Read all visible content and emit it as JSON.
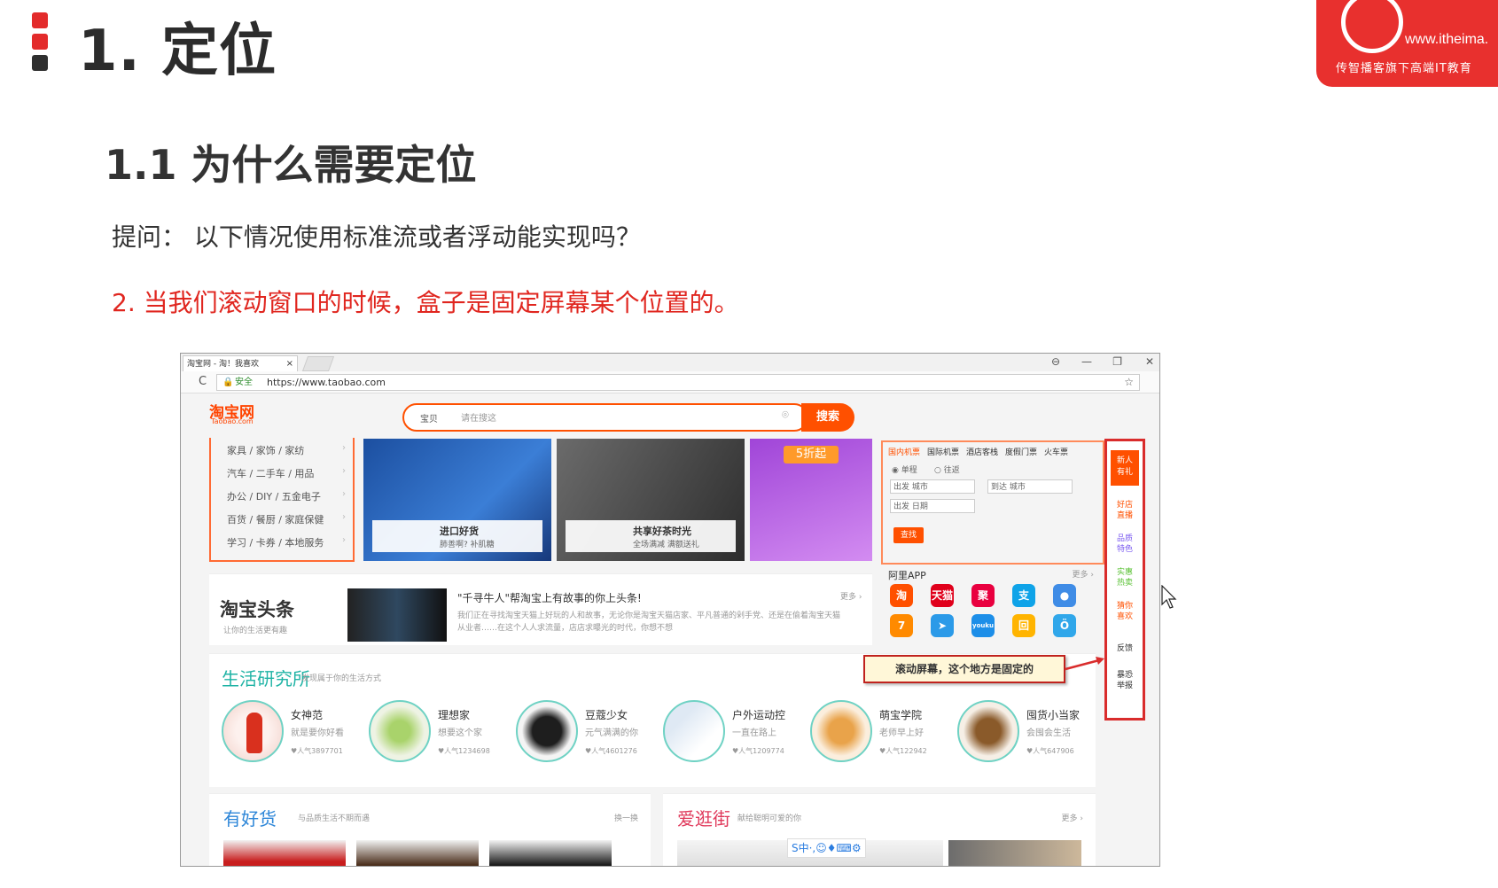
{
  "slide": {
    "h1": "1. 定位",
    "h2": "1.1 为什么需要定位",
    "question": "提问： 以下情况使用标准流或者浮动能实现吗？",
    "point2": "2. 当我们滚动窗口的时候，盒子是固定屏幕某个位置的。"
  },
  "logo": {
    "url": "www.itheima.",
    "slogan": "传智播客旗下高端IT教育"
  },
  "browser": {
    "tab_title": "淘宝网 - 淘！我喜欢",
    "tab_close": "×",
    "window_buttons": [
      "⊖",
      "—",
      "❐",
      "✕"
    ],
    "reload": "C",
    "secure_label": "安全",
    "url": "https://www.taobao.com",
    "star": "☆"
  },
  "taobao": {
    "logo": "淘宝网",
    "logo_en": "Taobao.com",
    "search_type": "宝贝",
    "search_placeholder": "请在搜这",
    "search_button": "搜索",
    "categories": [
      "家具 / 家饰 / 家纺",
      "汽车 / 二手车 / 用品",
      "办公 / DIY / 五金电子",
      "百货 / 餐厨 / 家庭保健",
      "学习 / 卡券 / 本地服务"
    ],
    "banners": [
      {
        "title": "进口好货",
        "sub": "肺善啊? 补肌糖"
      },
      {
        "title": "共享好茶时光",
        "sub": "全场满减 满额送礼"
      },
      {
        "tag": "5折起"
      }
    ],
    "flight": {
      "tabs": [
        "国内机票",
        "国际机票",
        "酒店客栈",
        "度假门票",
        "火车票"
      ],
      "oneway": "单程",
      "return": "往返",
      "from": "出发  城市",
      "to": "到达  城市",
      "date": "出发  日期",
      "button": "查找"
    },
    "news": {
      "logo": "淘宝头条",
      "sub": "让你的生活更有趣",
      "title": "\"千寻牛人\"帮淘宝上有故事的你上头条!",
      "body": "我们正在寻找淘宝天猫上好玩的人和故事，无论你是淘宝天猫店家、平凡普通的剁手党、还是在偷着淘宝天猫从业者……在这个人人求流量，店店求曝光的时代，你想不想",
      "more": "更多 ›"
    },
    "ali_app": {
      "title": "阿里APP",
      "more": "更多 ›",
      "apps": [
        {
          "label": "淘",
          "color": "#ff5000"
        },
        {
          "label": "天猫",
          "color": "#e0001b"
        },
        {
          "label": "聚",
          "color": "#e9003f"
        },
        {
          "label": "支",
          "color": "#0fa3e8"
        },
        {
          "label": "●",
          "color": "#3f8ce6"
        },
        {
          "label": "7",
          "color": "#ff8a00"
        },
        {
          "label": "➤",
          "color": "#2b9ae8"
        },
        {
          "label": "youku",
          "color": "#1c8ee8"
        },
        {
          "label": "回",
          "color": "#ffb400"
        },
        {
          "label": "Ö",
          "color": "#30a7ea"
        }
      ]
    },
    "life": {
      "title": "生活研究所",
      "sub": "发现属于你的生活方式",
      "items": [
        {
          "title": "女神范",
          "sub": "就是要你好看",
          "hot": "♥人气3897701"
        },
        {
          "title": "理想家",
          "sub": "想要这个家",
          "hot": "♥人气1234698"
        },
        {
          "title": "豆蔻少女",
          "sub": "元气满满的你",
          "hot": "♥人气4601276"
        },
        {
          "title": "户外运动控",
          "sub": "一直在路上",
          "hot": "♥人气1209774"
        },
        {
          "title": "萌宝学院",
          "sub": "老师早上好",
          "hot": "♥人气122942"
        },
        {
          "title": "囤货小当家",
          "sub": "会囤会生活",
          "hot": "♥人气647906"
        }
      ]
    },
    "callout": "滚动屏幕，这个地方是固定的",
    "good": {
      "title": "有好货",
      "sub": "与品质生活不期而遇",
      "more": "换一换"
    },
    "ifashion": {
      "title": "爱逛街",
      "sub": "献给聪明可爱的你",
      "more": "更多 ›"
    },
    "ime_bar": "S中·,☺♦⌨⚙",
    "fixed_bar": {
      "top": "新人\n有礼",
      "items": [
        {
          "label": "好店\n直播",
          "color": "#ff5000"
        },
        {
          "label": "品质\n特色",
          "color": "#7a5af0"
        },
        {
          "label": "实惠\n热卖",
          "color": "#5bc236"
        },
        {
          "label": "猜你\n喜欢",
          "color": "#ff5000"
        },
        {
          "label": "反馈",
          "color": "#333333"
        },
        {
          "label": "暴恐\n举报",
          "color": "#333333"
        }
      ]
    }
  }
}
